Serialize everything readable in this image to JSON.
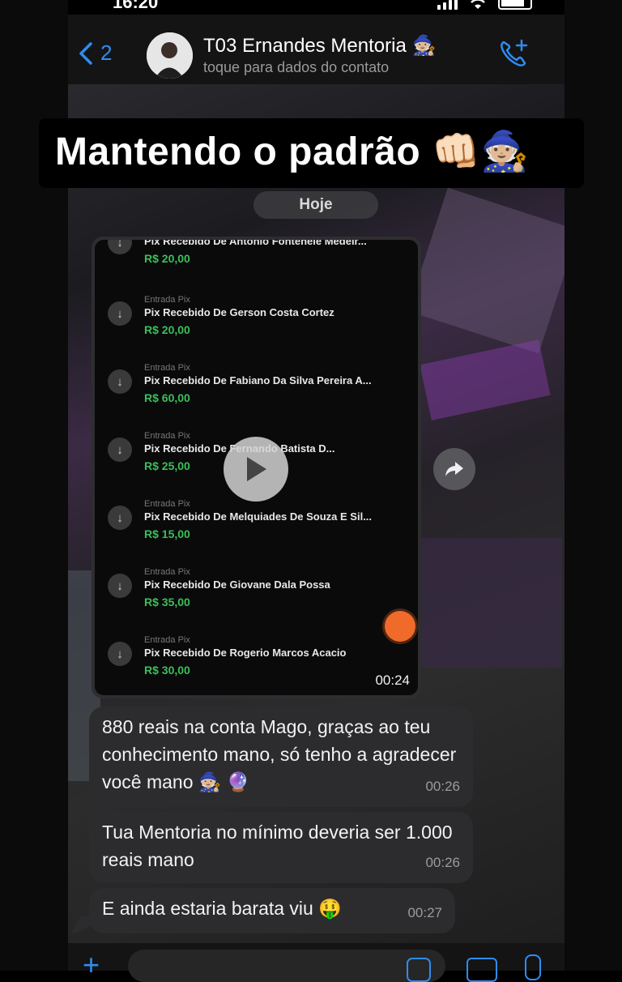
{
  "status_bar": {
    "time": "16:20"
  },
  "header": {
    "back_count": "2",
    "contact_name": "T03 Ernandes Mentoria 🧙🏼",
    "contact_subtitle": "toque para dados do contato",
    "accent_color": "#2f8cf2"
  },
  "story_caption": "Mantendo o padrão 👊🏻🧙🏼",
  "date_separator": "Hoje",
  "video_message": {
    "duration": "00:24",
    "pix_entries": [
      {
        "type": "",
        "title": "Pix Recebido De Antonio Fontenele Medeir...",
        "amount": "R$ 20,00"
      },
      {
        "type": "Entrada Pix",
        "title": "Pix Recebido De Gerson Costa Cortez",
        "amount": "R$ 20,00"
      },
      {
        "type": "Entrada Pix",
        "title": "Pix Recebido De Fabiano Da Silva Pereira A...",
        "amount": "R$ 60,00"
      },
      {
        "type": "Entrada Pix",
        "title": "Pix Recebido De Fernando Batista D...",
        "amount": "R$ 25,00"
      },
      {
        "type": "Entrada Pix",
        "title": "Pix Recebido De Melquiades De Souza E Sil...",
        "amount": "R$ 15,00"
      },
      {
        "type": "Entrada Pix",
        "title": "Pix Recebido De Giovane Dala Possa",
        "amount": "R$ 35,00"
      },
      {
        "type": "Entrada Pix",
        "title": "Pix Recebido De Rogerio Marcos Acacio",
        "amount": "R$ 30,00"
      }
    ]
  },
  "messages": [
    {
      "text": "880 reais na conta Mago, graças ao teu conhecimento mano, só tenho a agradecer você mano 🧙🏼 🔮",
      "time": "00:26"
    },
    {
      "text": "Tua Mentoria no mínimo deveria ser 1.000 reais mano",
      "time": "00:26"
    },
    {
      "text": "E ainda estaria barata viu 🤑",
      "time": "00:27"
    }
  ]
}
